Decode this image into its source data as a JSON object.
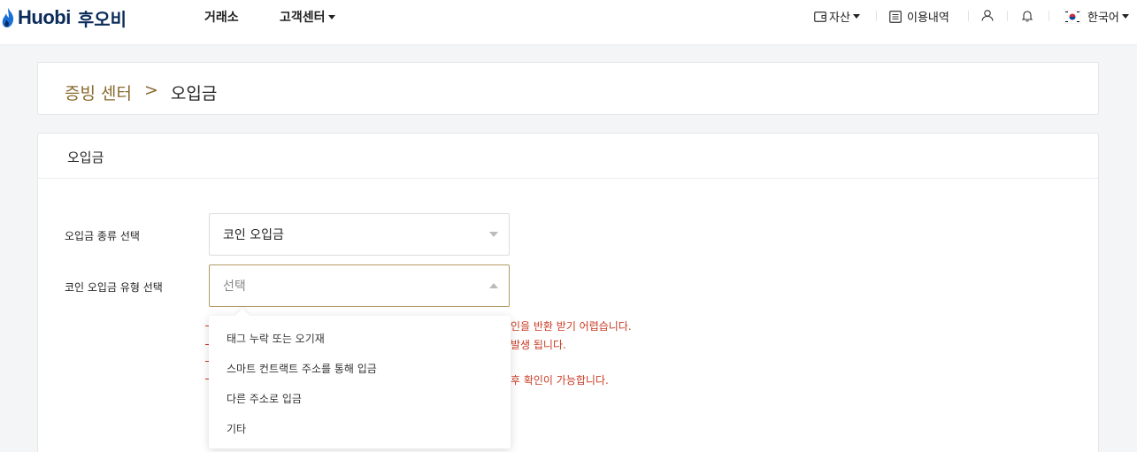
{
  "header": {
    "logo_text": "Huobi",
    "logo_ko": "후오비",
    "nav": [
      {
        "label": "거래소"
      },
      {
        "label": "고객센터"
      }
    ],
    "right": {
      "assets": "자산",
      "history": "이용내역",
      "language": "한국어"
    }
  },
  "breadcrumb": {
    "parent": "증빙 센터",
    "separator": ">",
    "current": "오입금"
  },
  "panel": {
    "title": "오입금",
    "fields": [
      {
        "label": "오입금 종류 선택",
        "value": "코인 오입금"
      },
      {
        "label": "코인 오입금 유형 선택",
        "placeholder": "선택"
      }
    ],
    "warnings": [
      "인을 반환 받기 어렵습니다.",
      "발생 됩니다.",
      "후 확인이 가능합니다."
    ]
  },
  "dropdown": {
    "options": [
      "태그 누락 또는 오기재",
      "스마트 컨트랙트 주소를 통해 입금",
      "다른 주소로 입금",
      "기타"
    ]
  },
  "colors": {
    "accent_gold": "#8a6a2f",
    "warning_red": "#c93b23",
    "logo_navy": "#0b2b5a"
  }
}
